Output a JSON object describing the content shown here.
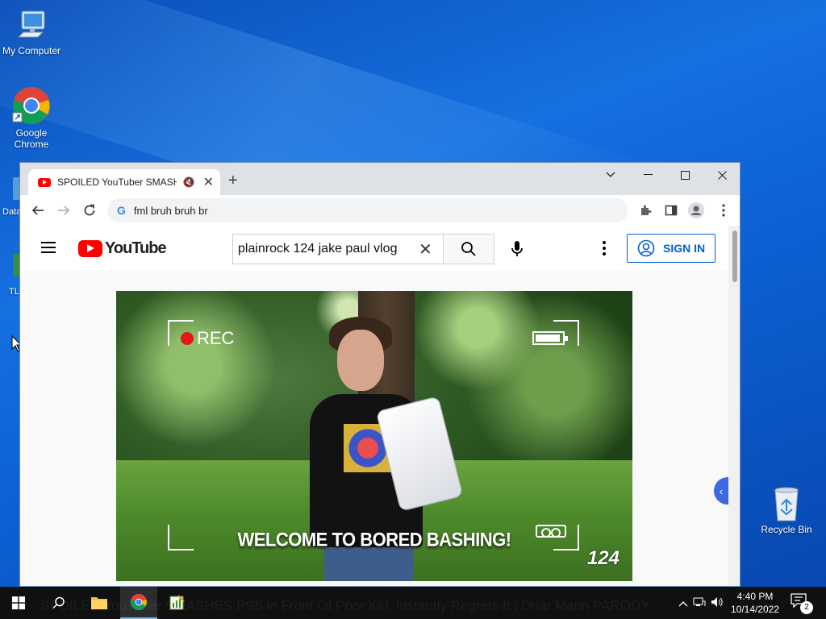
{
  "desktop": {
    "icons": [
      {
        "label": "My Computer",
        "icon": "computer-icon"
      },
      {
        "label": "Google Chrome",
        "icon": "chrome-icon"
      },
      {
        "label": "Recycle Bin",
        "icon": "recycle-bin-icon"
      }
    ],
    "partial_labels": [
      "Data",
      "TL"
    ]
  },
  "browser": {
    "tab": {
      "title": "SPOILED YouTuber SMASHES PS5 In Front Of Poor Kid, Instantly Regrets It | Dhar Mann PARODY",
      "muted": true
    },
    "omnibox": {
      "value": "fml bruh bruh br"
    },
    "window_controls": [
      "chevron-down",
      "minimize",
      "maximize",
      "close"
    ]
  },
  "youtube": {
    "logo_text": "YouTube",
    "search": {
      "value": "plainrock 124 jake paul vlog"
    },
    "sign_in_label": "SIGN IN",
    "video": {
      "overlay_rec": "REC",
      "caption": "WELCOME TO BORED BASHING!",
      "channel_number": "124"
    }
  },
  "taskbar": {
    "title_text": "SPOILED YouTuber SMASHES PS5 In Front Of Poor Kid, Instantly Regrets It | Dhar Mann PARODY",
    "clock_time": "4:40 PM",
    "clock_date": "10/14/2022",
    "notification_count": "2"
  },
  "colors": {
    "youtube_red": "#ff0000",
    "link_blue": "#065fd4",
    "desktop_blue": "#0d62d6"
  }
}
